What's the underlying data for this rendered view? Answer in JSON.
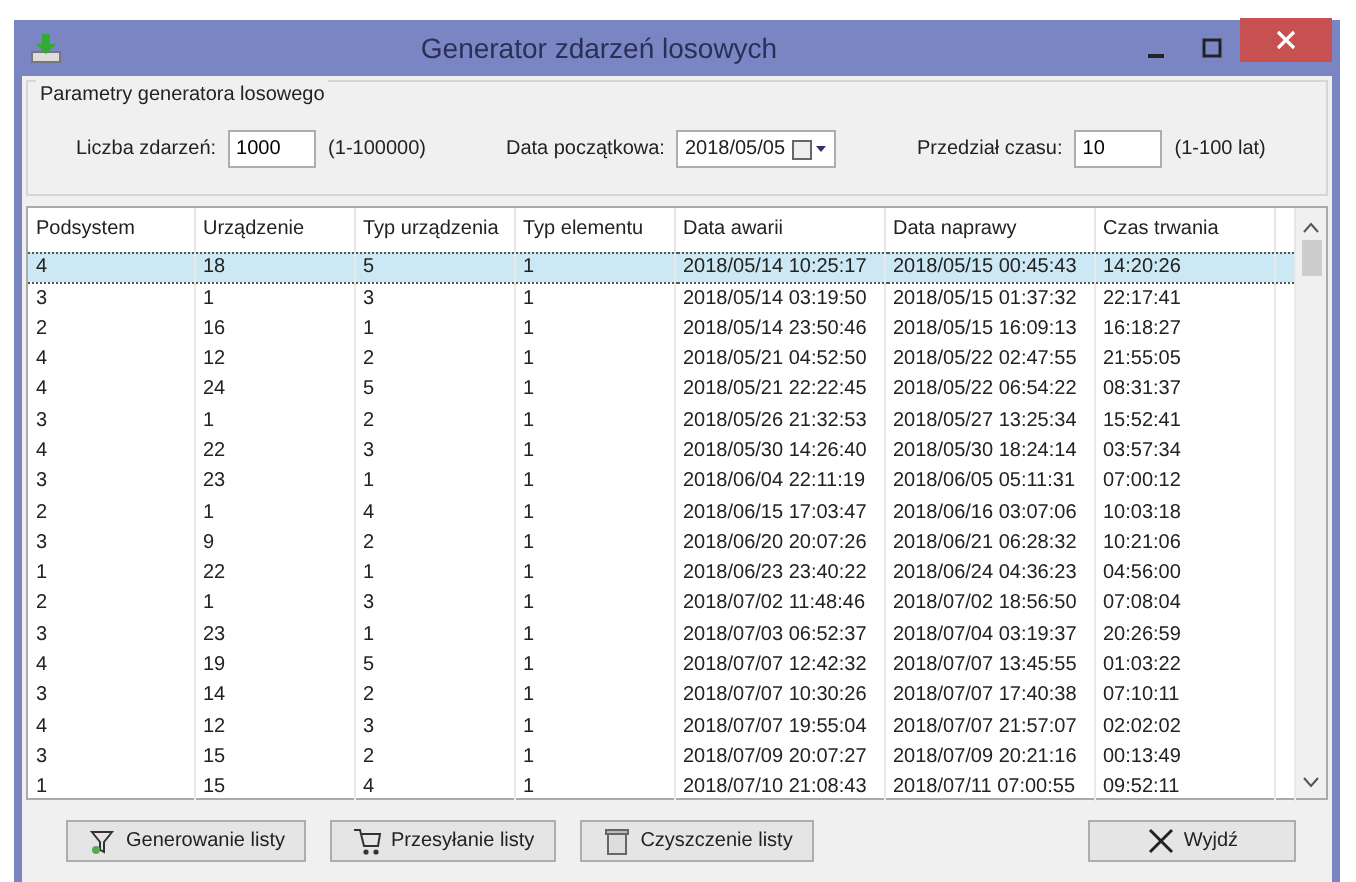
{
  "window": {
    "title": "Generator zdarzeń losowych"
  },
  "params": {
    "title": "Parametry generatora losowego",
    "fields": [
      {
        "label": "Liczba zdarzeń:",
        "value": "1000",
        "hint": "(1-100000)",
        "kind": "text"
      },
      {
        "label": "Data początkowa:",
        "value": "2018/05/05",
        "kind": "date"
      },
      {
        "label": "Przedział czasu:",
        "value": "10",
        "hint": "(1-100 lat)",
        "kind": "text"
      }
    ]
  },
  "table": {
    "columns": [
      "Podsystem",
      "Urządzenie",
      "Typ urządzenia",
      "Typ elementu",
      "Data awarii",
      "Data naprawy",
      "Czas trwania"
    ],
    "rows": [
      {
        "selected": true,
        "cells": [
          "4",
          "18",
          "5",
          "1",
          "2018/05/14 10:25:17",
          "2018/05/15 00:45:43",
          "14:20:26"
        ]
      },
      {
        "selected": false,
        "cells": [
          "3",
          "1",
          "3",
          "1",
          "2018/05/14 03:19:50",
          "2018/05/15 01:37:32",
          "22:17:41"
        ]
      },
      {
        "selected": false,
        "cells": [
          "2",
          "16",
          "1",
          "1",
          "2018/05/14 23:50:46",
          "2018/05/15 16:09:13",
          "16:18:27"
        ]
      },
      {
        "selected": false,
        "cells": [
          "4",
          "12",
          "2",
          "1",
          "2018/05/21 04:52:50",
          "2018/05/22 02:47:55",
          "21:55:05"
        ]
      },
      {
        "selected": false,
        "cells": [
          "4",
          "24",
          "5",
          "1",
          "2018/05/21 22:22:45",
          "2018/05/22 06:54:22",
          "08:31:37"
        ]
      },
      {
        "selected": false,
        "cells": [
          "3",
          "1",
          "2",
          "1",
          "2018/05/26 21:32:53",
          "2018/05/27 13:25:34",
          "15:52:41"
        ]
      },
      {
        "selected": false,
        "cells": [
          "4",
          "22",
          "3",
          "1",
          "2018/05/30 14:26:40",
          "2018/05/30 18:24:14",
          "03:57:34"
        ]
      },
      {
        "selected": false,
        "cells": [
          "3",
          "23",
          "1",
          "1",
          "2018/06/04 22:11:19",
          "2018/06/05 05:11:31",
          "07:00:12"
        ]
      },
      {
        "selected": false,
        "cells": [
          "2",
          "1",
          "4",
          "1",
          "2018/06/15 17:03:47",
          "2018/06/16 03:07:06",
          "10:03:18"
        ]
      },
      {
        "selected": false,
        "cells": [
          "3",
          "9",
          "2",
          "1",
          "2018/06/20 20:07:26",
          "2018/06/21 06:28:32",
          "10:21:06"
        ]
      },
      {
        "selected": false,
        "cells": [
          "1",
          "22",
          "1",
          "1",
          "2018/06/23 23:40:22",
          "2018/06/24 04:36:23",
          "04:56:00"
        ]
      },
      {
        "selected": false,
        "cells": [
          "2",
          "1",
          "3",
          "1",
          "2018/07/02 11:48:46",
          "2018/07/02 18:56:50",
          "07:08:04"
        ]
      },
      {
        "selected": false,
        "cells": [
          "3",
          "23",
          "1",
          "1",
          "2018/07/03 06:52:37",
          "2018/07/04 03:19:37",
          "20:26:59"
        ]
      },
      {
        "selected": false,
        "cells": [
          "4",
          "19",
          "5",
          "1",
          "2018/07/07 12:42:32",
          "2018/07/07 13:45:55",
          "01:03:22"
        ]
      },
      {
        "selected": false,
        "cells": [
          "3",
          "14",
          "2",
          "1",
          "2018/07/07 10:30:26",
          "2018/07/07 17:40:38",
          "07:10:11"
        ]
      },
      {
        "selected": false,
        "cells": [
          "4",
          "12",
          "3",
          "1",
          "2018/07/07 19:55:04",
          "2018/07/07 21:57:07",
          "02:02:02"
        ]
      },
      {
        "selected": false,
        "cells": [
          "3",
          "15",
          "2",
          "1",
          "2018/07/09 20:07:27",
          "2018/07/09 20:21:16",
          "00:13:49"
        ]
      },
      {
        "selected": false,
        "cells": [
          "1",
          "15",
          "4",
          "1",
          "2018/07/10 21:08:43",
          "2018/07/11 07:00:55",
          "09:52:11"
        ]
      }
    ]
  },
  "buttons": [
    {
      "label": "Generowanie listy",
      "kind": "generate"
    },
    {
      "label": "Przesyłanie listy",
      "kind": "cart"
    },
    {
      "label": "Czyszczenie listy",
      "kind": "trash"
    },
    {
      "label": "Wyjdź",
      "kind": "exit"
    }
  ]
}
